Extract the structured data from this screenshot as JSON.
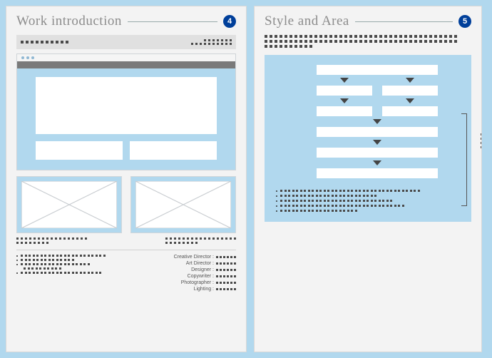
{
  "left": {
    "title": "Work introduction",
    "badge": "4",
    "credits": [
      {
        "label": "Creative Director :"
      },
      {
        "label": "Art Director :"
      },
      {
        "label": "Designer :"
      },
      {
        "label": "Copywriter :"
      },
      {
        "label": "Photographer :"
      },
      {
        "label": "Lighting :"
      }
    ]
  },
  "right": {
    "title": "Style and Area",
    "badge": "5"
  }
}
